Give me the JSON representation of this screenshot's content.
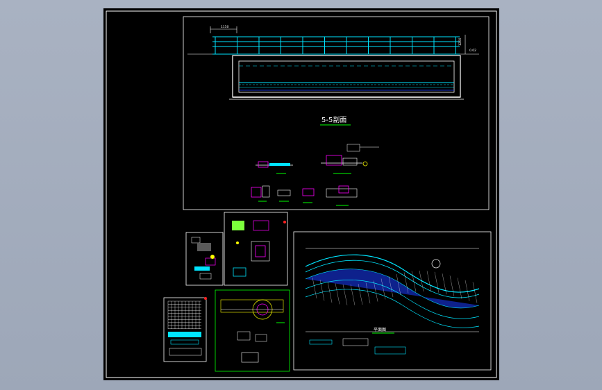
{
  "viewer": {
    "background_color": "#a3acbd",
    "sheet_color": "#000000"
  },
  "drawing": {
    "section_title": "5-5剖面",
    "railing_width_dim": "1150",
    "railing_height_dim": "1200",
    "right_elevation_label": "0.02",
    "curve_plan_title": "平面图"
  },
  "colors": {
    "cyan": "#00e5ff",
    "white": "#ffffff",
    "green": "#00ff00",
    "blue": "#1a3cff",
    "magenta": "#ff00ff",
    "yellow": "#ffff00",
    "red": "#ff2020"
  }
}
